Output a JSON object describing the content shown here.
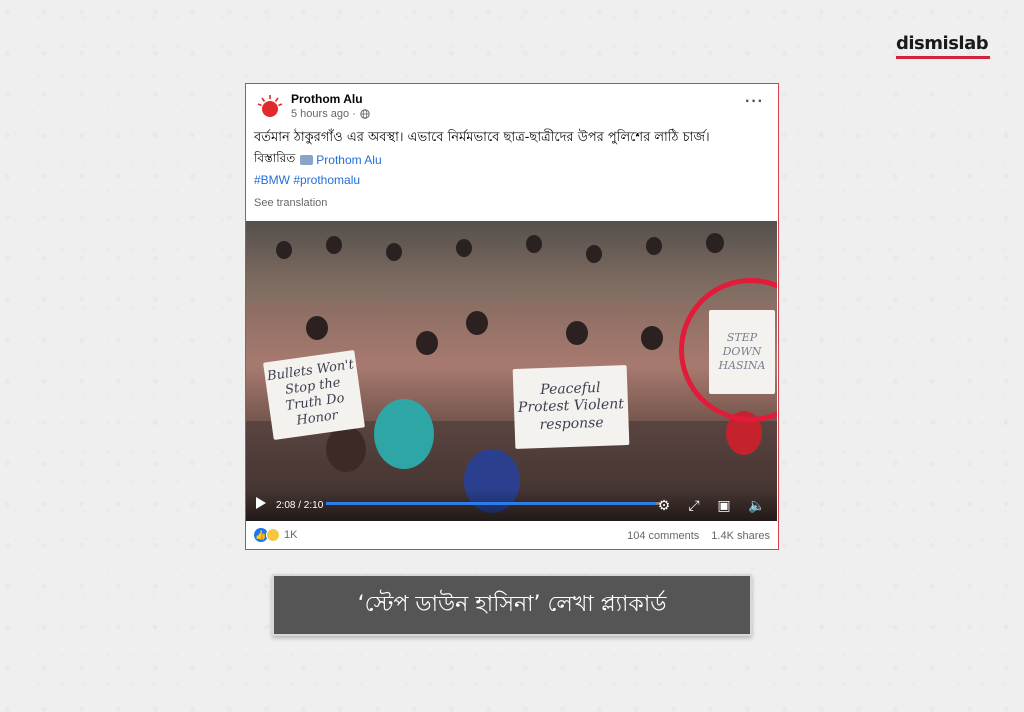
{
  "brand": {
    "name": "dismislab",
    "accent": "#d3223b"
  },
  "post": {
    "page_name": "Prothom Alu",
    "time": "5 hours ago ·",
    "caption": "বর্তমান ঠাকুরগাঁও এর অবস্থা। এভাবে নির্মমভাবে ছাত্র-ছাত্রীদের উপর পুলিশের লাঠি চার্জ।",
    "details_prefix": "বিস্তারিত",
    "details_link": "Prothom Alu",
    "hashtags": "#BMW #prothomalu",
    "see_translation": "See translation",
    "video": {
      "time_display": "2:08 / 2:10",
      "progress": 0.985,
      "placards": {
        "bullets": "Bullets Won't Stop the Truth Do Honor",
        "peaceful": "Peaceful Protest Violent response",
        "stepdown": "STEP DOWN HASINA"
      }
    },
    "reactions_count": "1K",
    "comments": "104 comments",
    "shares": "1.4K shares"
  },
  "label": "‘স্টেপ ডাউন হাসিনা’ লেখা প্ল্যাকার্ড",
  "colors": {
    "highlight": "#e21b3a",
    "link": "#216fdb",
    "border": "#d84050"
  }
}
